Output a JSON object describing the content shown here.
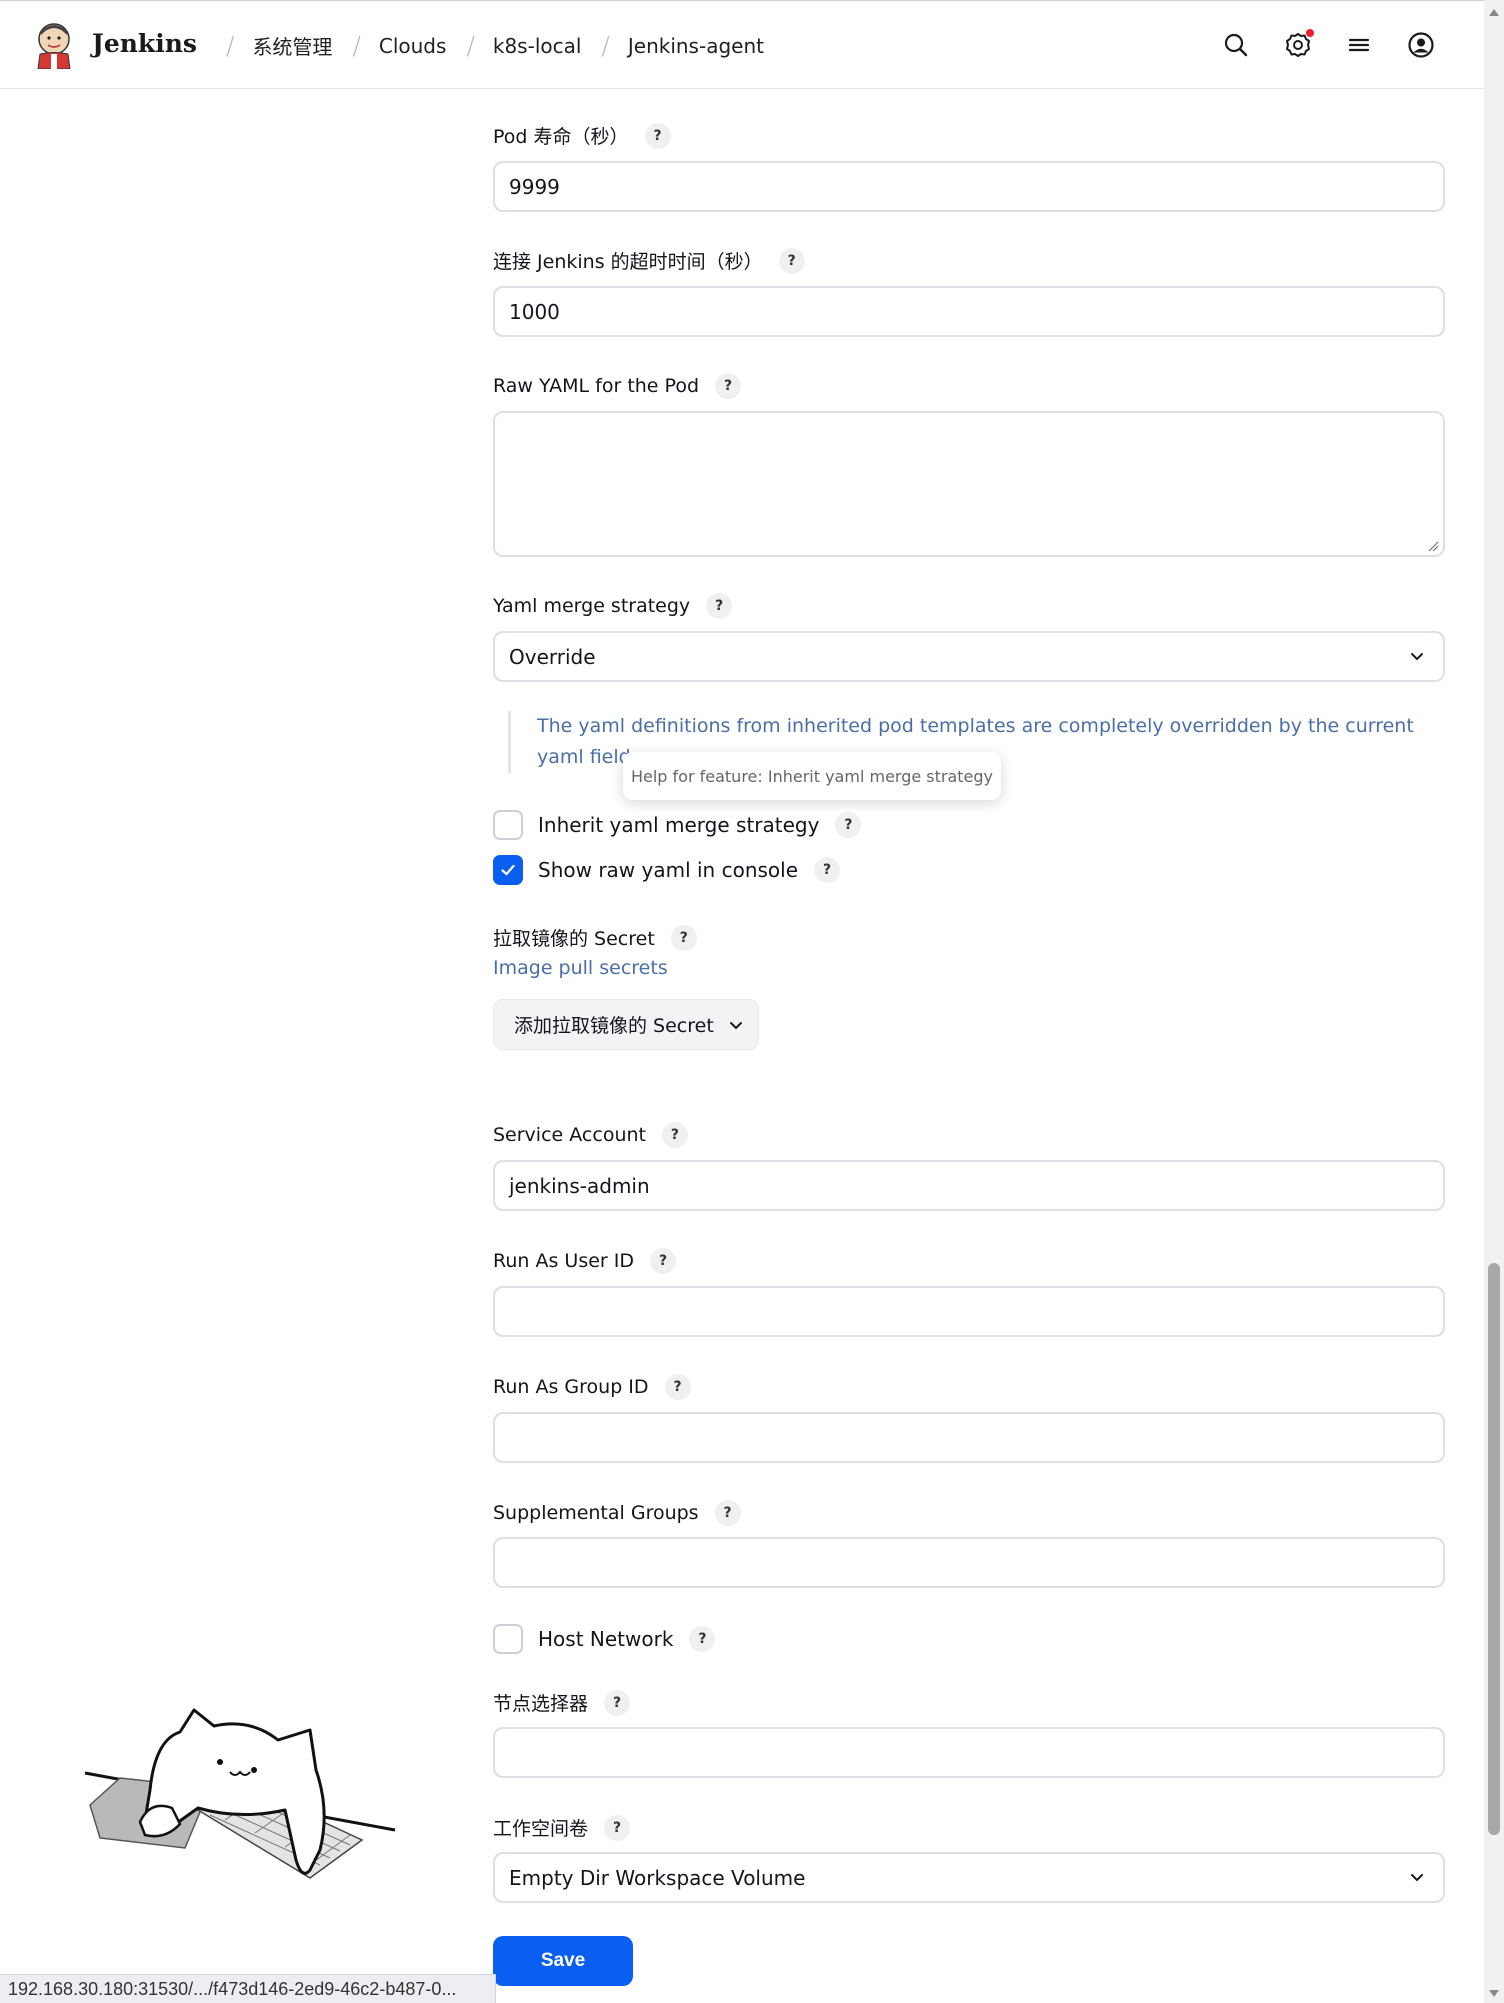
{
  "header": {
    "brand": "Jenkins",
    "breadcrumbs": [
      "系统管理",
      "Clouds",
      "k8s-local",
      "Jenkins-agent"
    ],
    "icons": [
      "search-icon",
      "settings-icon",
      "menu-icon",
      "user-icon"
    ],
    "notification": true
  },
  "form": {
    "pod_lifetime": {
      "label": "Pod 寿命（秒）",
      "value": "9999"
    },
    "connect_timeout": {
      "label": "连接 Jenkins 的超时时间（秒）",
      "value": "1000"
    },
    "raw_yaml": {
      "label": "Raw YAML for the Pod",
      "value": ""
    },
    "yaml_merge": {
      "label": "Yaml merge strategy",
      "selected": "Override",
      "help": "The yaml definitions from inherited pod templates are completely overridden by the current yaml field."
    },
    "tooltip": "Help for feature: Inherit yaml merge strategy",
    "inherit_yaml": {
      "label": "Inherit yaml merge strategy",
      "checked": false
    },
    "show_raw_yaml": {
      "label": "Show raw yaml in console",
      "checked": true
    },
    "image_pull": {
      "label": "拉取镜像的 Secret",
      "sub": "Image pull secrets",
      "button": "添加拉取镜像的 Secret"
    },
    "service_account": {
      "label": "Service Account",
      "value": "jenkins-admin"
    },
    "run_as_user": {
      "label": "Run As User ID",
      "value": ""
    },
    "run_as_group": {
      "label": "Run As Group ID",
      "value": ""
    },
    "supplemental_groups": {
      "label": "Supplemental Groups",
      "value": ""
    },
    "host_network": {
      "label": "Host Network",
      "checked": false
    },
    "node_selector": {
      "label": "节点选择器",
      "value": ""
    },
    "workspace_volume": {
      "label": "工作空间卷",
      "selected": "Empty Dir Workspace Volume"
    },
    "help_mark": "?",
    "save": "Save"
  },
  "status_bar": "192.168.30.180:31530/.../f473d146-2ed9-46c2-b487-0...",
  "colors": {
    "accent": "#0b5ff0",
    "help_text": "#4a6fa5",
    "notification": "#e5222d"
  }
}
